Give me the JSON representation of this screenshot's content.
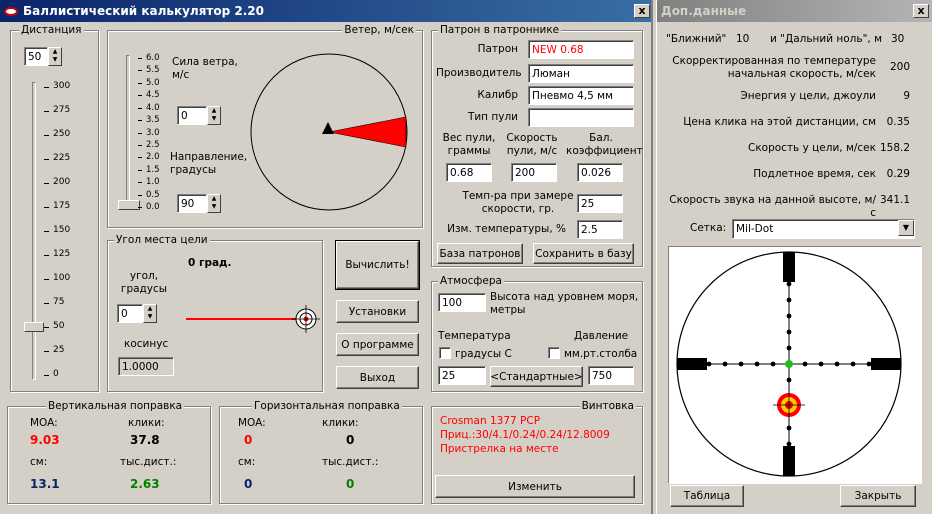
{
  "main_window": {
    "title": "Баллистический калькулятор 2.20",
    "close": "x"
  },
  "side_window": {
    "title": "Доп.данные",
    "close": "x"
  },
  "distance": {
    "title": "Дистанция",
    "value": "50",
    "ticks": [
      "300",
      "275",
      "250",
      "225",
      "200",
      "175",
      "150",
      "125",
      "100",
      "75",
      "50",
      "25",
      "0"
    ],
    "slider_level_m": 50
  },
  "wind": {
    "title": "Ветер, м/сек",
    "ticks": [
      "6.0",
      "5.5",
      "5.0",
      "4.5",
      "4.0",
      "3.5",
      "3.0",
      "2.5",
      "2.0",
      "1.5",
      "1.0",
      "0.5",
      "0.0"
    ],
    "force_label": "Сила ветра, м/с",
    "force_value": "0",
    "dir_label": "Направление, градусы",
    "dir_value": "90"
  },
  "angle": {
    "title": "Угол места цели",
    "deg_text": "0 град.",
    "label": "угол, градусы",
    "value": "0",
    "cos_label": "косинус",
    "cos_value": "1.0000"
  },
  "buttons": {
    "calc": "Вычислить!",
    "settings": "Установки",
    "about": "О программе",
    "exit": "Выход"
  },
  "cartridge": {
    "title": "Патрон в патроннике",
    "cartridge_label": "Патрон",
    "cartridge_value": "NEW 0.68",
    "maker_label": "Производитель",
    "maker_value": "Люман",
    "caliber_label": "Калибр",
    "caliber_value": "Пневмо 4,5 мм",
    "type_label": "Тип пули",
    "type_value": "",
    "weight_label": "Вес пули, граммы",
    "weight_value": "0.68",
    "speed_label": "Скорость пули, м/с",
    "speed_value": "200",
    "bc_label": "Бал. коэффициент",
    "bc_value": "0.026",
    "temp_label": "Темп-ра при замере скорости, гр.",
    "temp_value": "25",
    "temp_change_label": "Изм. температуры, %",
    "temp_change_value": "2.5",
    "db_button": "База патронов",
    "save_button": "Сохранить в базу"
  },
  "atmosphere": {
    "title": "Атмосфера",
    "alt_value": "100",
    "alt_label": "Высота над уровнем моря, метры",
    "temp_label": "Температура",
    "pressure_label": "Давление",
    "celsius_label": "градусы С",
    "mmhg_label": "мм.рт.столба",
    "temp_value": "25",
    "standard_button": "<Стандартные>",
    "pressure_value": "750"
  },
  "vertical": {
    "title": "Вертикальная поправка",
    "moa_label": "MOA:",
    "moa_value": "9.03",
    "clicks_label": "клики:",
    "clicks_value": "37.8",
    "cm_label": "см:",
    "cm_value": "13.1",
    "tds_label": "тыс.дист.:",
    "tds_value": "2.63"
  },
  "horizontal": {
    "title": "Горизонтальная поправка",
    "moa_label": "MOA:",
    "moa_value": "0",
    "clicks_label": "клики:",
    "clicks_value": "0",
    "cm_label": "см:",
    "cm_value": "0",
    "tds_label": "тыс.дист.:",
    "tds_value": "0"
  },
  "rifle": {
    "title": "Винтовка",
    "name": "Crosman 1377 PCP",
    "scope": "Приц.:30/4.1/0.24/0.24/12.8009",
    "zero": "Пристрелка на месте",
    "change_button": "Изменить"
  },
  "extra": {
    "near_label": "\"Ближний\"",
    "near_value": "10",
    "far_label": "и \"Дальний ноль\", м",
    "far_value": "30",
    "rows": [
      {
        "label": "Скорректированная по температуре начальная скорость, м/сек",
        "value": "200"
      },
      {
        "label": "Энергия у цели, джоули",
        "value": "9"
      },
      {
        "label": "Цена клика на этой дистанции, см",
        "value": "0.35"
      },
      {
        "label": "Скорость у цели, м/сек",
        "value": "158.2"
      },
      {
        "label": "Подлетное время, сек",
        "value": "0.29"
      },
      {
        "label": "Скорость звука на данной высоте, м/с",
        "value": "341.1"
      }
    ],
    "reticle_label": "Сетка:",
    "reticle_value": "Mil-Dot",
    "table_button": "Таблица",
    "close_button": "Закрыть"
  },
  "colors": {
    "red": "#ff0000",
    "darkred": "#c00000",
    "blue": "#0a246a",
    "green": "#008000"
  }
}
